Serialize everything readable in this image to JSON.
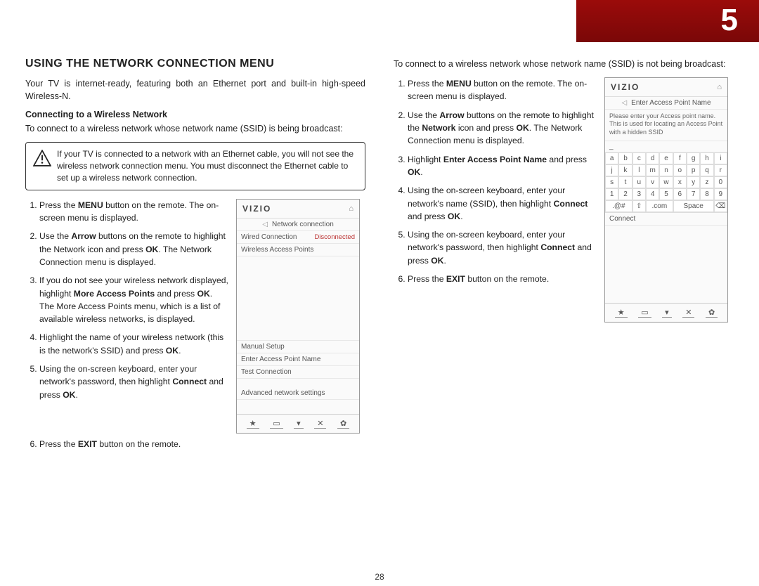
{
  "chapter": "5",
  "page_number": "28",
  "heading": "USING THE NETWORK CONNECTION MENU",
  "intro": "Your TV is internet-ready, featuring both an Ethernet port and built-in high-speed Wireless-N.",
  "sub1_title": "Connecting to a Wireless Network",
  "sub1_intro": "To connect to a wireless network whose network name (SSID) is being broadcast:",
  "callout1": "If your TV is connected to a network with an Ethernet cable, you will not see the wireless network connection menu. You must disconnect the Ethernet cable to set up a wireless network connection.",
  "stepsA": {
    "s1": "Press the MENU button on the remote. The on-screen menu is displayed.",
    "s2": "Use the Arrow buttons on the remote to highlight the Network icon and press OK. The Network Connection menu is displayed.",
    "s3": "If you do not see your wireless network displayed, highlight More Access Points and press OK. The More Access Points menu, which is a list of available wireless networks, is displayed.",
    "s4": "Highlight the name of your wireless network (this is the network's SSID) and press OK.",
    "s5": "Using the on-screen keyboard, enter your network's password, then highlight Connect and press OK.",
    "s6": "Press the EXIT button on the remote."
  },
  "col2_intro": "To connect to a wireless network whose network name (SSID) is not being broadcast:",
  "stepsB": {
    "s1": "Press the MENU button on the remote. The on-screen menu is displayed.",
    "s2": "Use the Arrow buttons on the remote to highlight the Network icon and press OK. The Network Connection menu is displayed.",
    "s3": "Highlight Enter Access Point Name and press OK.",
    "s4": "Using the on-screen keyboard, enter your network's name (SSID), then highlight Connect and press OK.",
    "s5": "Using the on-screen keyboard, enter your network's password, then highlight Connect and press OK.",
    "s6": "Press the EXIT button on the remote."
  },
  "screen1": {
    "logo": "VIZIO",
    "title": "Network connection",
    "wired_label": "Wired Connection",
    "wired_status": "Disconnected",
    "wireless_label": "Wireless Access Points",
    "manual": "Manual Setup",
    "enter_ap": "Enter Access Point Name",
    "test": "Test Connection",
    "advanced": "Advanced network settings",
    "foot": {
      "a": "★",
      "b": "▭",
      "c": "▾",
      "d": "✕",
      "e": "✿"
    }
  },
  "screen2": {
    "logo": "VIZIO",
    "title": "Enter Access Point Name",
    "desc": "Please enter your Access point name. This is used for locating an Access Point with a hidden SSID",
    "keys_row1": [
      "a",
      "b",
      "c",
      "d",
      "e",
      "f",
      "g",
      "h",
      "i"
    ],
    "keys_row2": [
      "j",
      "k",
      "l",
      "m",
      "n",
      "o",
      "p",
      "q",
      "r"
    ],
    "keys_row3": [
      "s",
      "t",
      "u",
      "v",
      "w",
      "x",
      "y",
      "z",
      "0"
    ],
    "keys_row4": [
      "1",
      "2",
      "3",
      "4",
      "5",
      "6",
      "7",
      "8",
      "9"
    ],
    "sym": ".@#",
    "shift": "⇧",
    "com": ".com",
    "space": "Space",
    "bksp": "⌫",
    "connect": "Connect",
    "foot": {
      "a": "★",
      "b": "▭",
      "c": "▾",
      "d": "✕",
      "e": "✿"
    }
  }
}
